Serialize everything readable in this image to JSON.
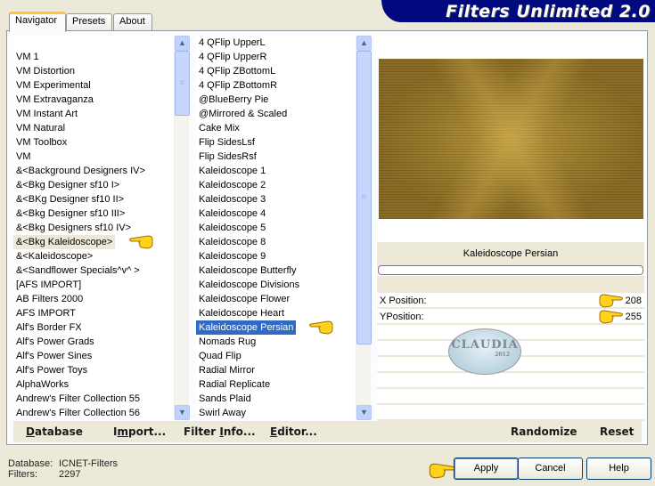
{
  "app": {
    "title": "Filters Unlimited 2.0"
  },
  "tabs": [
    {
      "label": "Navigator",
      "active": true
    },
    {
      "label": "Presets",
      "active": false
    },
    {
      "label": "About",
      "active": false
    }
  ],
  "categories": {
    "items": [
      "",
      "VM 1",
      "VM Distortion",
      "VM Experimental",
      "VM Extravaganza",
      "VM Instant Art",
      "VM Natural",
      "VM Toolbox",
      "VM",
      "&<Background Designers IV>",
      "&<Bkg Designer sf10 I>",
      "&<BKg Designer sf10 II>",
      "&<Bkg Designer sf10 III>",
      "&<Bkg Designers sf10 IV>",
      "&<Bkg Kaleidoscope>",
      "&<Kaleidoscope>",
      "&<Sandflower Specials^v^ >",
      "[AFS IMPORT]",
      "AB Filters 2000",
      "AFS IMPORT",
      "Alf's Border FX",
      "Alf's Power Grads",
      "Alf's Power Sines",
      "Alf's Power Toys",
      "AlphaWorks",
      "Andrew's Filter Collection 55",
      "Andrew's Filter Collection 56"
    ],
    "highlighted": "&<Bkg Kaleidoscope>"
  },
  "filters": {
    "items": [
      "4 QFlip UpperL",
      "4 QFlip UpperR",
      "4 QFlip ZBottomL",
      "4 QFlip ZBottomR",
      "@BlueBerry Pie",
      "@Mirrored & Scaled",
      "Cake Mix",
      "Flip SidesLsf",
      "Flip SidesRsf",
      "Kaleidoscope 1",
      "Kaleidoscope 2",
      "Kaleidoscope 3",
      "Kaleidoscope 4",
      "Kaleidoscope 5",
      "Kaleidoscope 8",
      "Kaleidoscope 9",
      "Kaleidoscope Butterfly",
      "Kaleidoscope Divisions",
      "Kaleidoscope Flower",
      "Kaleidoscope Heart",
      "Kaleidoscope Persian",
      "Nomads Rug",
      "Quad Flip",
      "Radial Mirror",
      "Radial Replicate",
      "Sands Plaid",
      "Swirl Away"
    ],
    "selected": "Kaleidoscope Persian"
  },
  "preview": {
    "filter_name": "Kaleidoscope Persian",
    "params": [
      {
        "label": "X Position:",
        "value": "208"
      },
      {
        "label": "YPosition:",
        "value": "255"
      }
    ],
    "watermark": {
      "text": "CLAUDIA",
      "sub": "2012"
    }
  },
  "bottom_bar": {
    "database": {
      "label": "Database",
      "underline": "D",
      "rest": "atabase"
    },
    "import": {
      "pre": "I",
      "underline": "m",
      "rest": "port..."
    },
    "filter_info": {
      "pre": "Filter ",
      "underline": "I",
      "rest": "nfo..."
    },
    "editor": {
      "underline": "E",
      "rest": "ditor..."
    },
    "randomize": "Randomize",
    "reset": "Reset"
  },
  "status": {
    "database_label": "Database:",
    "database_value": "ICNET-Filters",
    "filters_label": "Filters:",
    "filters_value": "2297"
  },
  "buttons": {
    "apply": "Apply",
    "cancel": "Cancel",
    "help": "Help"
  },
  "colors": {
    "banner": "#000a7e",
    "selection": "#316ac5",
    "window_bg": "#ece9d8"
  }
}
